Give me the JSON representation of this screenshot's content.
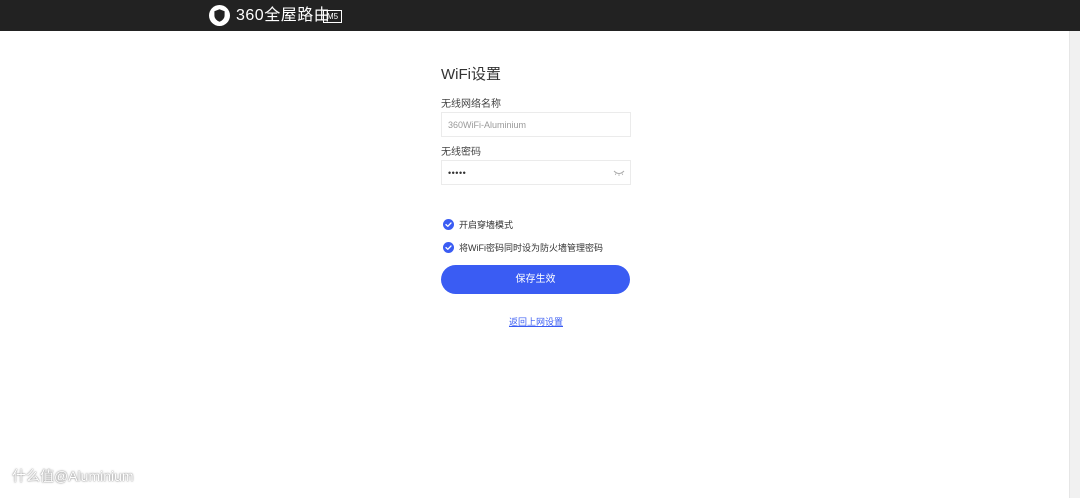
{
  "header": {
    "brand_text": "360全屋路由",
    "model_badge": "M5"
  },
  "form": {
    "title": "WiFi设置",
    "ssid_label": "无线网络名称",
    "ssid_value": "360WiFi-Aluminium",
    "password_label": "无线密码",
    "password_value": "•••••",
    "options": [
      {
        "label": "开启穿墙模式",
        "checked": true
      },
      {
        "label": "将WiFi密码同时设为防火墙管理密码",
        "checked": true
      }
    ],
    "save_label": "保存生效",
    "back_link": "返回上网设置"
  },
  "watermark": "什么值@Aluminium",
  "colors": {
    "topbar": "#222222",
    "accent": "#3a5cf3",
    "check": "#3a5cf3"
  },
  "icons": {
    "logo": "shield-logo-icon",
    "check": "check-circle-icon",
    "eye": "eye-closed-icon"
  }
}
